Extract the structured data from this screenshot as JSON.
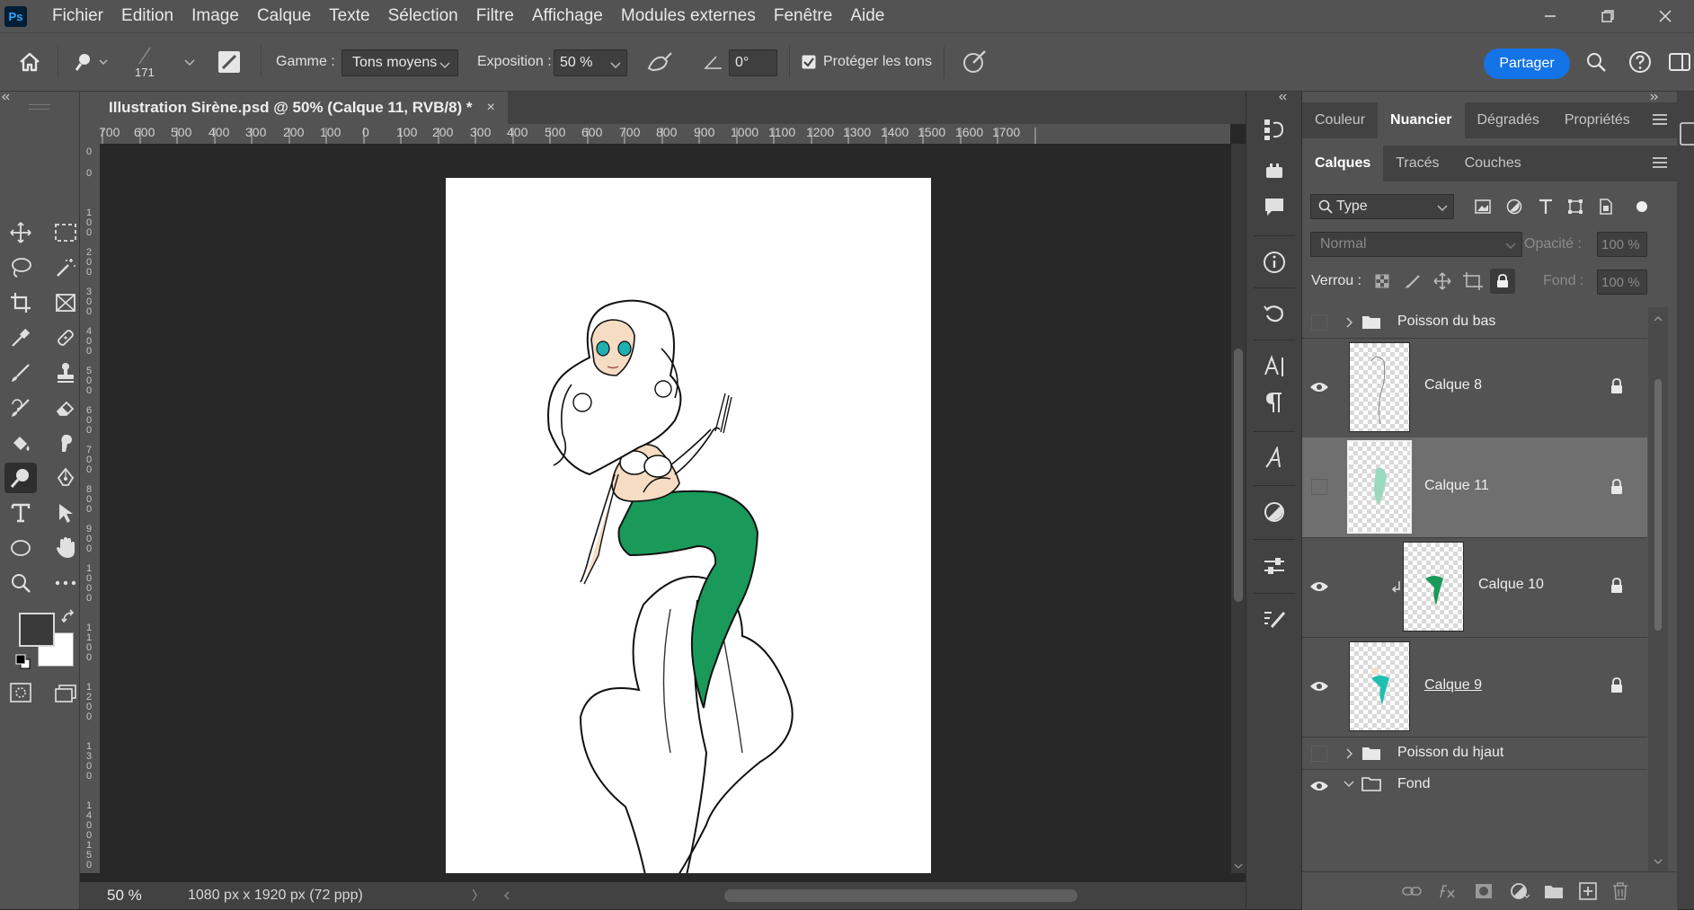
{
  "app": {
    "logo_text": "Ps"
  },
  "menu": {
    "items": [
      "Fichier",
      "Edition",
      "Image",
      "Calque",
      "Texte",
      "Sélection",
      "Filtre",
      "Affichage",
      "Modules externes",
      "Fenêtre",
      "Aide"
    ]
  },
  "options": {
    "brush_size": "171",
    "range_label": "Gamme :",
    "range_value": "Tons moyens",
    "exposure_label": "Exposition :",
    "exposure_value": "50 %",
    "angle_value": "0°",
    "protect_tones_label": "Protéger les tons",
    "protect_tones_checked": true,
    "share_label": "Partager"
  },
  "document": {
    "tab_title": "Illustration Sirène.psd @ 50% (Calque 11, RVB/8) *",
    "tab_close": "×",
    "ruler_top": [
      "700",
      "600",
      "500",
      "400",
      "300",
      "200",
      "100",
      "0",
      "100",
      "200",
      "300",
      "400",
      "500",
      "600",
      "700",
      "800",
      "900",
      "1000",
      "1100",
      "1200",
      "1300",
      "1400",
      "1500",
      "1600",
      "1700"
    ],
    "ruler_left": [
      "0",
      "0",
      "1 0 0",
      "2 0 0",
      "3 0 0",
      "4 0 0",
      "5 0 0",
      "6 0 0",
      "7 0 0",
      "8 0 0",
      "9 0 0",
      "1 0 0 0",
      "1 1 0 0",
      "1 2 0 0",
      "1 3 0 0",
      "1 4 0 0",
      "1 5 0"
    ],
    "zoom": "50 %",
    "doc_info": "1080 px x 1920 px (72 ppp)",
    "status_arrow": "〉"
  },
  "panels": {
    "top_tabs": [
      "Couleur",
      "Nuancier",
      "Dégradés",
      "Propriétés"
    ],
    "top_active": "Nuancier",
    "layer_tabs": [
      "Calques",
      "Tracés",
      "Couches"
    ],
    "layer_active": "Calques",
    "filter_value": "Type",
    "blend_mode": "Normal",
    "opacity_label": "Opacité :",
    "opacity_value": "100 %",
    "lock_label": "Verrou :",
    "fill_label": "Fond :",
    "fill_value": "100 %",
    "layers": [
      {
        "name": "Poisson du bas",
        "kind": "group"
      },
      {
        "name": "Calque 8",
        "kind": "layer"
      },
      {
        "name": "Calque 11",
        "kind": "layer"
      },
      {
        "name": "Calque 10",
        "kind": "layer"
      },
      {
        "name": "Calque 9",
        "kind": "layer"
      },
      {
        "name": "Poisson du hjaut",
        "kind": "group"
      },
      {
        "name": "Fond",
        "kind": "group"
      }
    ]
  },
  "colors": {
    "accent": "#1473e6",
    "foreground": "#3a3a3a",
    "background": "#ffffff",
    "tail_green": "#1a9a5a",
    "skin": "#f5dcc2"
  }
}
